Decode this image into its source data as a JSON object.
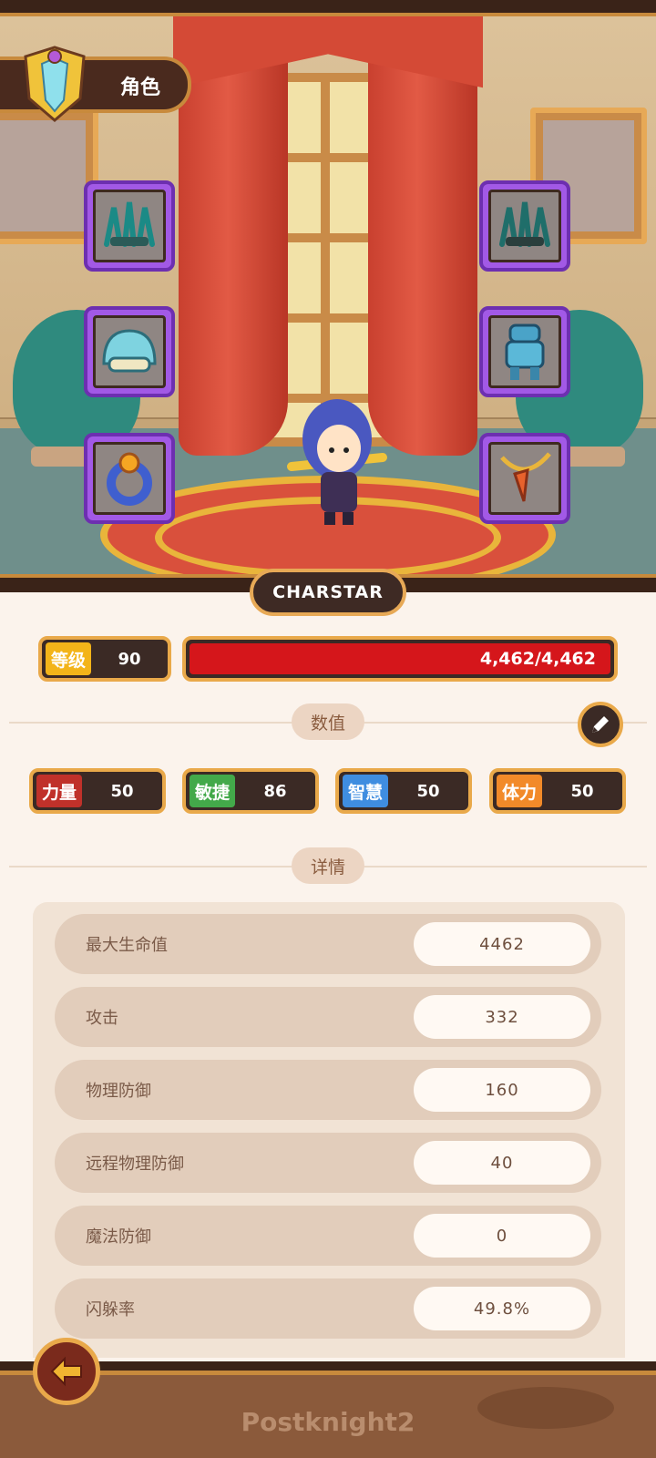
{
  "header": {
    "title": "角色"
  },
  "character": {
    "name": "CHARSTAR"
  },
  "level": {
    "label": "等级",
    "value": "90"
  },
  "hp": {
    "text": "4,462/4,462",
    "fraction": 1.0
  },
  "sections": {
    "stats": "数值",
    "details": "详情"
  },
  "attributes": [
    {
      "label": "力量",
      "value": "50"
    },
    {
      "label": "敏捷",
      "value": "86"
    },
    {
      "label": "智慧",
      "value": "50"
    },
    {
      "label": "体力",
      "value": "50"
    }
  ],
  "details": [
    {
      "label": "最大生命值",
      "value": "4462"
    },
    {
      "label": "攻击",
      "value": "332"
    },
    {
      "label": "物理防御",
      "value": "160"
    },
    {
      "label": "远程物理防御",
      "value": "40"
    },
    {
      "label": "魔法防御",
      "value": "0"
    },
    {
      "label": "闪躲率",
      "value": "49.8%"
    }
  ],
  "equipment": [
    "claws-icon",
    "helmet-icon",
    "ring-icon",
    "claws-icon",
    "armor-icon",
    "amulet-icon"
  ],
  "footer": {
    "logo": "Postknight2"
  },
  "colors": {
    "hp": "#d5161b",
    "slot": "#a259e6",
    "accent": "#e9a94a"
  }
}
